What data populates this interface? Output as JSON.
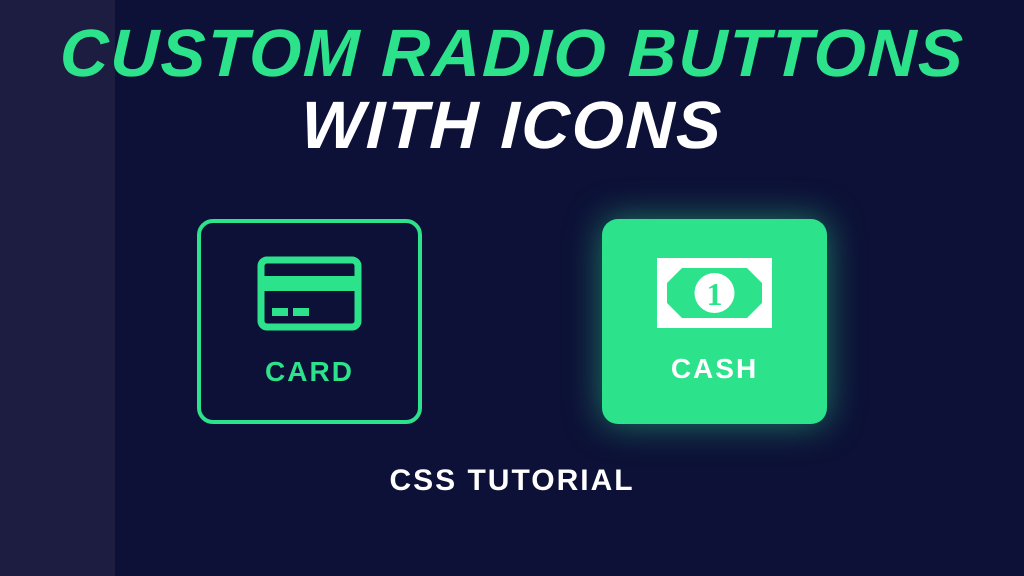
{
  "title": {
    "line1": "CUSTOM RADIO BUTTONS",
    "line2": "WITH ICONS"
  },
  "options": {
    "card": {
      "label": "CARD",
      "selected": false,
      "icon": "credit-card-icon"
    },
    "cash": {
      "label": "CASH",
      "selected": true,
      "icon": "cash-bill-icon"
    }
  },
  "footer": "CSS TUTORIAL",
  "colors": {
    "accent": "#2ce28b",
    "background": "#0d1137",
    "sidebar": "#1d1d42",
    "text": "#ffffff"
  }
}
